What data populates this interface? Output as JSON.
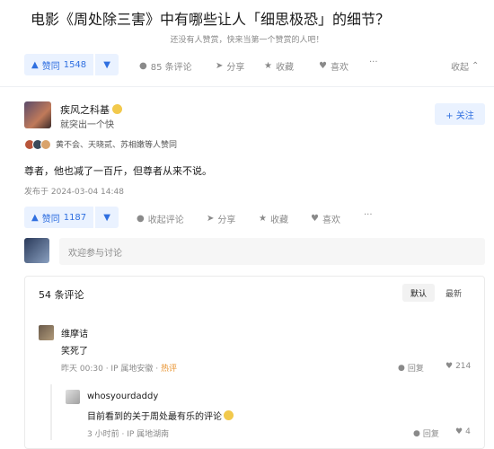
{
  "question": {
    "title": "电影《周处除三害》中有哪些让人「细思极恐」的细节？",
    "hint": "还没有人赞赏，快来当第一个赞赏的人吧！"
  },
  "top_actions": {
    "vote_label": "赞同",
    "vote_count": "1548",
    "comments": "85 条评论",
    "share": "分享",
    "favorite": "收藏",
    "like": "喜欢",
    "more": "···",
    "collapse": "收起"
  },
  "answer": {
    "author": "疾风之科基",
    "bio": "就突出一个快",
    "follow": "+ 关注",
    "voters": "黄不会、天晓贰、苏相嫩等人赞同",
    "content": "尊者，他也减了一百斤，但尊者从来不说。",
    "published": "发布于 2024-03-04 14:48"
  },
  "answer_actions": {
    "vote_label": "赞同",
    "vote_count": "1187",
    "comments": "收起评论",
    "share": "分享",
    "favorite": "收藏",
    "like": "喜欢",
    "more": "···"
  },
  "comment_input": {
    "placeholder": "欢迎参与讨论"
  },
  "comments": {
    "count": "54 条评论",
    "sort_default": "默认",
    "sort_latest": "最新",
    "items": [
      {
        "name": "维摩诘",
        "text": "笑死了",
        "time": "昨天 00:30",
        "ip": "IP 属地安徽",
        "tag": "热评",
        "reply": "回复",
        "likes": "214"
      },
      {
        "name": "whosyourdaddy",
        "text": "目前看到的关于周处最有乐的评论",
        "time": "3 小时前",
        "ip": "IP 属地湖南",
        "reply": "回复",
        "likes": "4"
      }
    ]
  },
  "colors": {
    "accent": "#2f6fe0",
    "accent_bg": "#eaf2ff",
    "hot": "#e8912c",
    "meta": "#8a8a8a"
  },
  "icons": [
    "caret-up-icon",
    "caret-down-icon",
    "comment-icon",
    "share-icon",
    "star-icon",
    "heart-icon",
    "more-icon",
    "chevron-up-icon",
    "reply-icon",
    "thumb-up-icon"
  ]
}
